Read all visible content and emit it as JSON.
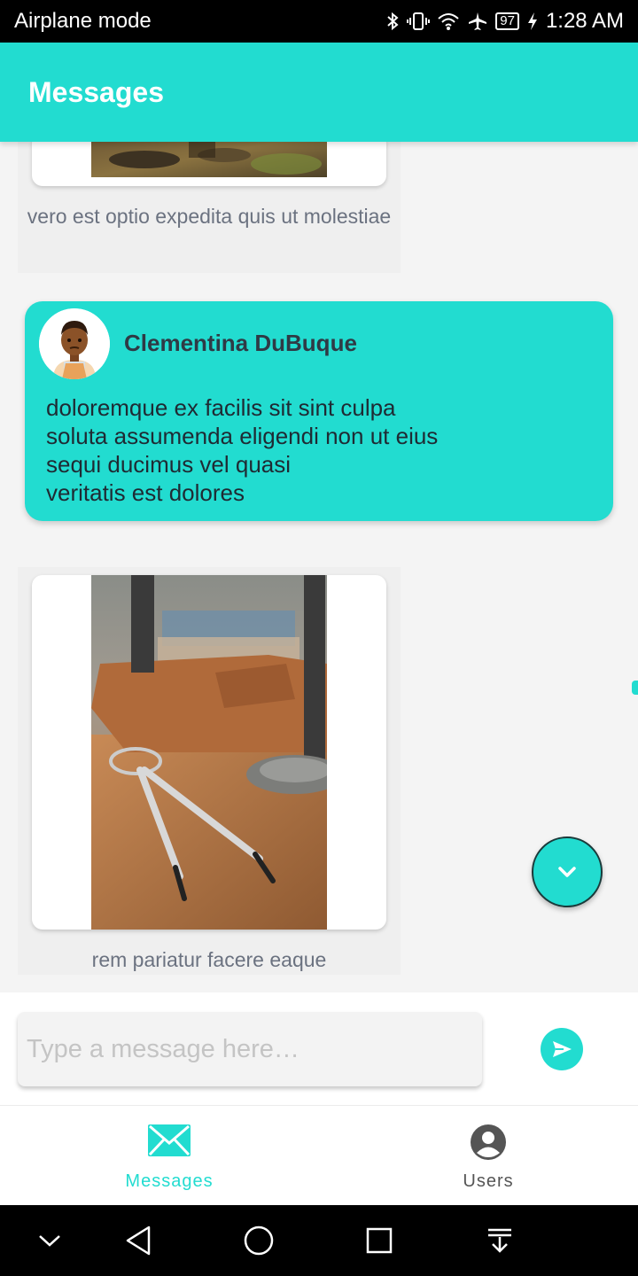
{
  "status_bar": {
    "mode": "Airplane mode",
    "battery": "97",
    "time": "1:28 AM"
  },
  "app_bar": {
    "title": "Messages"
  },
  "messages": [
    {
      "type": "image",
      "caption": "vero est optio expedita quis ut molestiae"
    },
    {
      "type": "text",
      "sender": "Clementina DuBuque",
      "lines": [
        "doloremque ex facilis sit sint culpa",
        "soluta assumenda eligendi non ut eius",
        "sequi ducimus vel quasi",
        "veritatis est dolores"
      ]
    },
    {
      "type": "image",
      "caption": "rem pariatur facere eaque"
    }
  ],
  "composer": {
    "placeholder": "Type a message here…"
  },
  "bottom_nav": {
    "items": [
      {
        "label": "Messages",
        "icon": "envelope-icon",
        "active": true
      },
      {
        "label": "Users",
        "icon": "account-circle-icon",
        "active": false
      }
    ]
  },
  "colors": {
    "accent": "#22dcd0",
    "text_dark": "#2f3a45",
    "caption": "#6b7280"
  }
}
